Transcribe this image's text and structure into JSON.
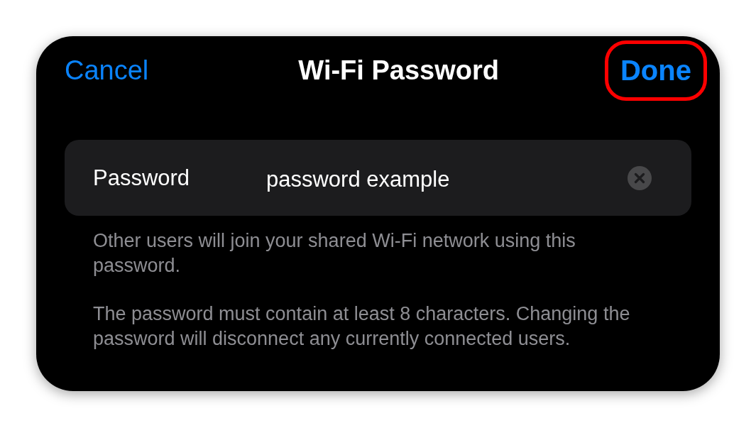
{
  "navigation_bar": {
    "cancel": "Cancel",
    "title": "Wi-Fi Password",
    "done": {
      "label": "Done",
      "highlighted": true
    }
  },
  "password_field": {
    "label": "Password",
    "value": "password example"
  },
  "footer_notes": [
    "Other users will join your shared Wi-Fi network using this password.",
    "The password must contain at least 8 characters. Changing the password will disconnect any currently connected users."
  ]
}
